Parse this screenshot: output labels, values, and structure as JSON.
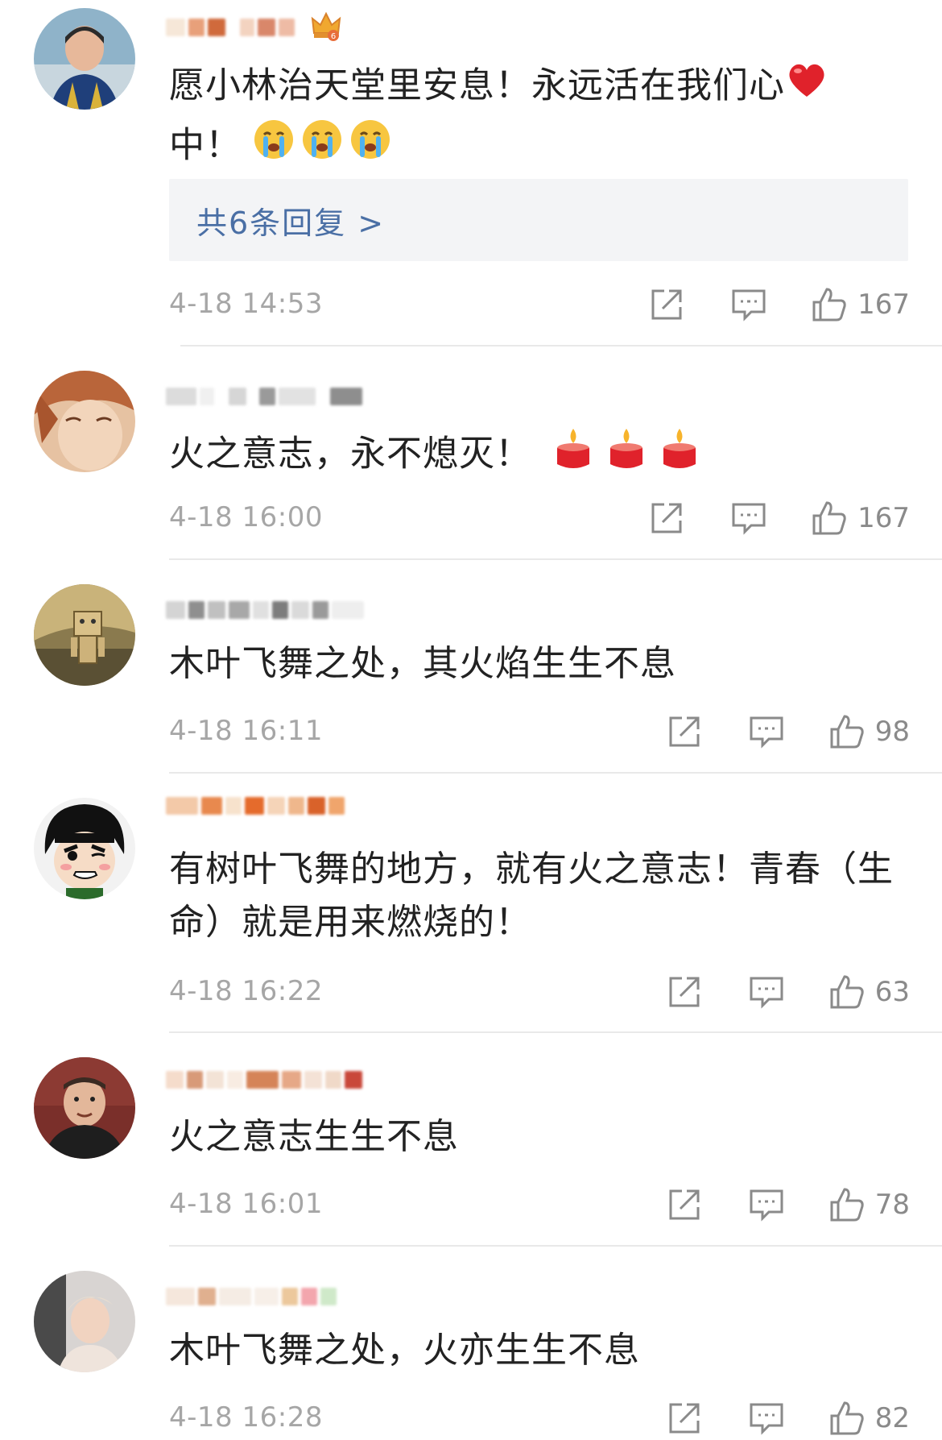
{
  "comments": [
    {
      "username": "",
      "text": "愿小林治天堂里安息！永远活在我们心",
      "text2": "中！",
      "emoji_heart": "heart-emoji",
      "emoji_end": "crying-emoji x3",
      "replies_label": "共6条回复 >",
      "time": "4-18 14:53",
      "likes": "167"
    },
    {
      "username": "",
      "text": "火之意志，永不熄灭！",
      "emoji_end": "candle-emoji x3",
      "time": "4-18 16:00",
      "likes": "167"
    },
    {
      "username": "",
      "text": "木叶飞舞之处，其火焰生生不息",
      "time": "4-18 16:11",
      "likes": "98"
    },
    {
      "username": "",
      "text": "有树叶飞舞的地方，就有火之意志！青春（生",
      "text2": "命）就是用来燃烧的！",
      "time": "4-18 16:22",
      "likes": "63"
    },
    {
      "username": "",
      "text": "火之意志生生不息",
      "time": "4-18 16:01",
      "likes": "78"
    },
    {
      "username": "",
      "text": "木叶飞舞之处，火亦生生不息",
      "time": "4-18 16:28",
      "likes": "82"
    }
  ],
  "colors": {
    "reply_link": "#4a6fa5",
    "meta_text": "#a6a6a6",
    "reply_box_bg": "#f3f4f6",
    "divider": "#e9e9e9"
  }
}
